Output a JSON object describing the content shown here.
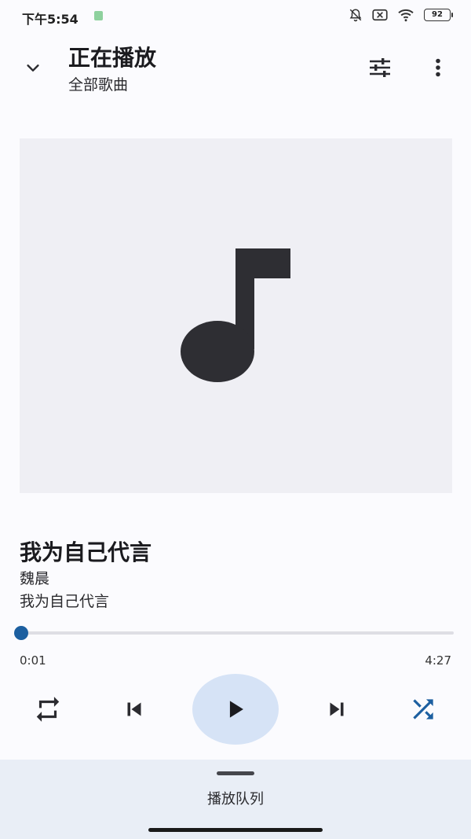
{
  "status_bar": {
    "time": "下午5:54",
    "battery": "92",
    "icons": [
      "app-notification-icon",
      "bell-muted-icon",
      "sim-disabled-icon",
      "wifi-icon",
      "battery-icon"
    ]
  },
  "header": {
    "title": "正在播放",
    "subtitle": "全部歌曲",
    "icons": [
      "chevron-down-icon",
      "equalizer-icon",
      "more-vert-icon"
    ]
  },
  "album_art": {
    "icon": "music-note-icon"
  },
  "song": {
    "title": "我为自己代言",
    "artist": "魏晨",
    "album": "我为自己代言"
  },
  "progress": {
    "current": "0:01",
    "total": "4:27",
    "fraction": 0.004
  },
  "controls": {
    "icons": [
      "repeat-icon",
      "skip-previous-icon",
      "play-icon",
      "skip-next-icon",
      "shuffle-icon"
    ]
  },
  "queue": {
    "label": "播放队列"
  },
  "colors": {
    "accent": "#1c5fa0",
    "play_button_bg": "#d6e3f6",
    "album_bg": "#efeff4",
    "sheet_bg": "#e9eef6",
    "icon_dark": "#2b2b30"
  }
}
